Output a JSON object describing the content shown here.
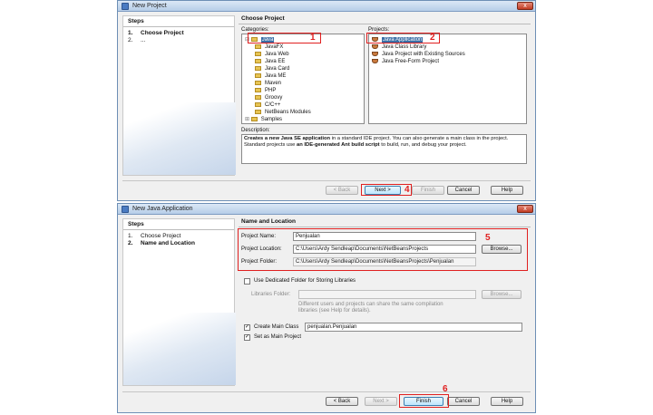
{
  "dialog1": {
    "title": "New Project",
    "close_glyph": "x",
    "steps_title": "Steps",
    "steps": [
      {
        "num": "1.",
        "label": "Choose Project"
      },
      {
        "num": "2.",
        "label": "..."
      }
    ],
    "panel_title": "Choose Project",
    "categories_label": "Categories:",
    "projects_label": "Projects:",
    "categories": [
      "Java",
      "JavaFX",
      "Java Web",
      "Java EE",
      "Java Card",
      "Java ME",
      "Maven",
      "PHP",
      "Groovy",
      "C/C++",
      "NetBeans Modules",
      "Samples"
    ],
    "projects": [
      "Java Application",
      "Java Class Library",
      "Java Project with Existing Sources",
      "Java Free-Form Project"
    ],
    "description_label": "Description:",
    "description": {
      "b1": "Creates a new Java SE application",
      "t1": " in a standard IDE project. You can also generate a main class in the project. Standard projects use ",
      "b2": "an IDE-generated Ant build script",
      "t2": " to build, run, and debug your project."
    },
    "buttons": {
      "back": "< Back",
      "next": "Next >",
      "finish": "Finish",
      "cancel": "Cancel",
      "help": "Help"
    }
  },
  "dialog2": {
    "title": "New Java Application",
    "close_glyph": "x",
    "steps_title": "Steps",
    "steps": [
      {
        "num": "1.",
        "label": "Choose Project"
      },
      {
        "num": "2.",
        "label": "Name and Location"
      }
    ],
    "panel_title": "Name and Location",
    "project_name_label": "Project Name:",
    "project_name": "Penjualan",
    "project_location_label": "Project Location:",
    "project_location": "C:\\Users\\Ardy Sendleap\\Documents\\NetBeansProjects",
    "project_folder_label": "Project Folder:",
    "project_folder": "C:\\Users\\Ardy Sendleap\\Documents\\NetBeansProjects\\Penjualan",
    "browse": "Browse...",
    "dedicated_folder_label": "Use Dedicated Folder for Storing Libraries",
    "libraries_folder_label": "Libraries Folder:",
    "libraries_note_1": "Different users and projects can share the same compilation",
    "libraries_note_2": "libraries (see Help for details).",
    "create_main_class_label": "Create Main Class",
    "main_class": "penjualan.Penjualan",
    "set_main_label": "Set as Main Project",
    "check_glyph": "✓",
    "buttons": {
      "back": "< Back",
      "next": "Next >",
      "finish": "Finish",
      "cancel": "Cancel",
      "help": "Help"
    }
  },
  "annotations": [
    "1",
    "2",
    "4",
    "5",
    "6"
  ],
  "colors": {
    "accent": "#3a6ea5",
    "annotation": "#e02020",
    "title_bar": "#c7d9ee"
  }
}
